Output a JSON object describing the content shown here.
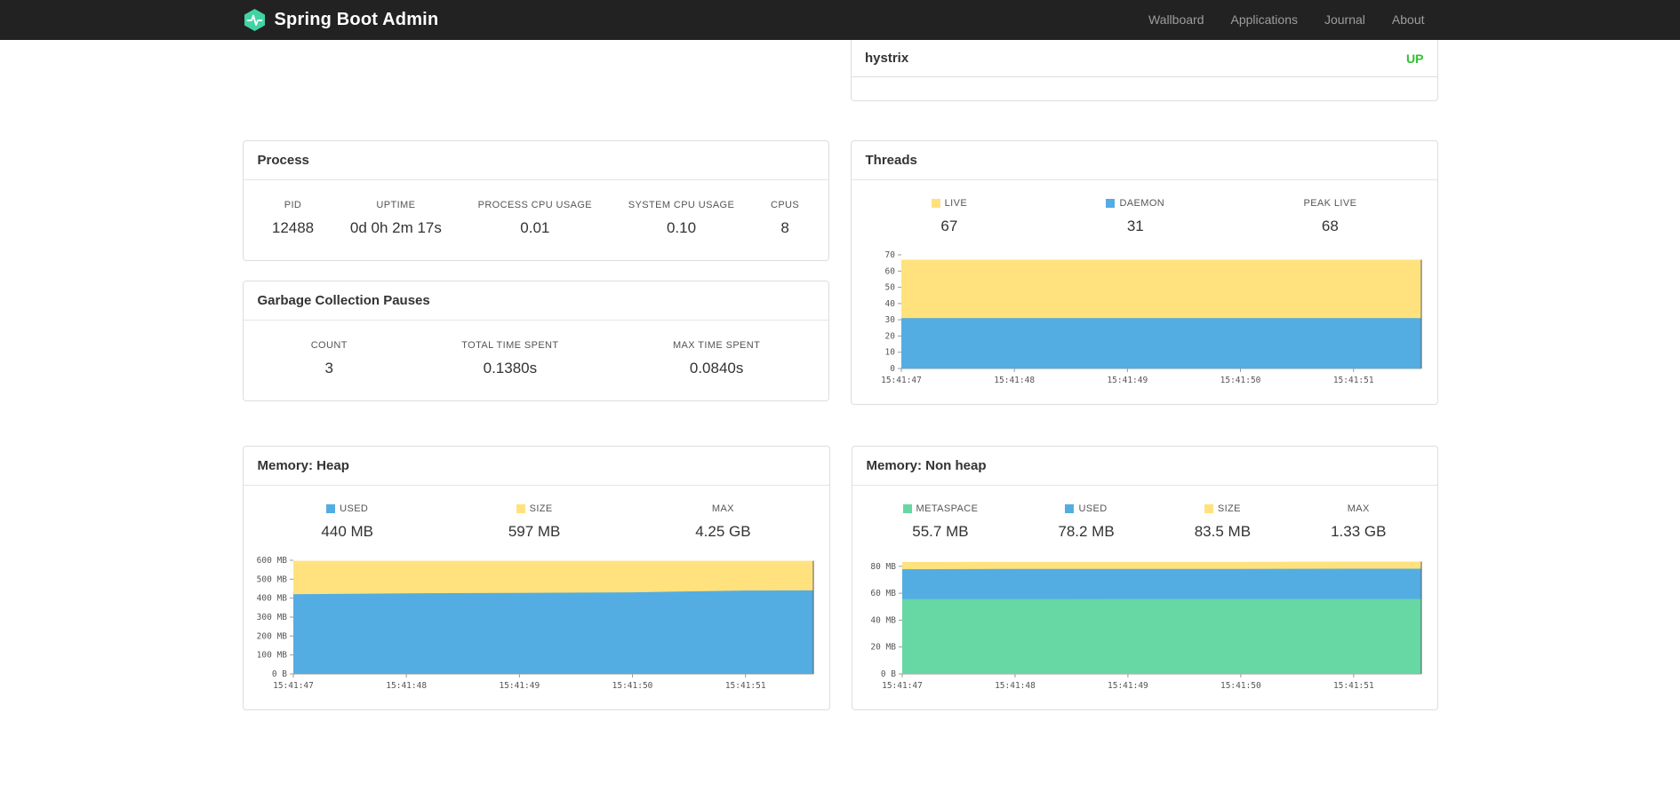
{
  "navbar": {
    "brand": "Spring Boot Admin",
    "links": [
      "Wallboard",
      "Applications",
      "Journal",
      "About"
    ]
  },
  "colors": {
    "brand": "#42d3a5",
    "navbar_bg": "#222222",
    "status_up": "#2fc32f",
    "chart_blue": "#53ade2",
    "chart_yellow": "#ffe27d",
    "chart_green": "#67d7a4"
  },
  "application_row": {
    "name": "hystrix",
    "status": "UP"
  },
  "process": {
    "title": "Process",
    "metrics": [
      {
        "label": "PID",
        "value": "12488"
      },
      {
        "label": "UPTIME",
        "value": "0d 0h 2m 17s"
      },
      {
        "label": "PROCESS CPU USAGE",
        "value": "0.01"
      },
      {
        "label": "SYSTEM CPU USAGE",
        "value": "0.10"
      },
      {
        "label": "CPUS",
        "value": "8"
      }
    ]
  },
  "gc": {
    "title": "Garbage Collection Pauses",
    "metrics": [
      {
        "label": "COUNT",
        "value": "3"
      },
      {
        "label": "TOTAL TIME SPENT",
        "value": "0.1380s"
      },
      {
        "label": "MAX TIME SPENT",
        "value": "0.0840s"
      }
    ]
  },
  "chart_data": [
    {
      "type": "area",
      "title": "Threads",
      "legend": [
        {
          "label": "LIVE",
          "value": "67",
          "color": "#ffe27d"
        },
        {
          "label": "DAEMON",
          "value": "31",
          "color": "#53ade2"
        },
        {
          "label": "PEAK LIVE",
          "value": "68"
        }
      ],
      "series": [
        {
          "name": "LIVE",
          "color": "#ffe27d",
          "values": [
            67,
            67,
            67,
            67,
            67,
            67
          ]
        },
        {
          "name": "DAEMON",
          "color": "#53ade2",
          "values": [
            31,
            31,
            31,
            31,
            31,
            31
          ]
        }
      ],
      "ylim": [
        0,
        70
      ],
      "y_ticks": [
        {
          "v": 0,
          "label": "0"
        },
        {
          "v": 10,
          "label": "10"
        },
        {
          "v": 20,
          "label": "20"
        },
        {
          "v": 30,
          "label": "30"
        },
        {
          "v": 40,
          "label": "40"
        },
        {
          "v": 50,
          "label": "50"
        },
        {
          "v": 60,
          "label": "60"
        },
        {
          "v": 70,
          "label": "70"
        }
      ],
      "x_ticks": [
        "15:41:47",
        "15:41:48",
        "15:41:49",
        "15:41:50",
        "15:41:51"
      ],
      "points_t": [
        0,
        1,
        2,
        3,
        4,
        4.6
      ],
      "x_overhang": 0.6
    },
    {
      "type": "area",
      "title": "Memory: Heap",
      "legend": [
        {
          "label": "USED",
          "value": "440 MB",
          "color": "#53ade2"
        },
        {
          "label": "SIZE",
          "value": "597 MB",
          "color": "#ffe27d"
        },
        {
          "label": "MAX",
          "value": "4.25 GB"
        }
      ],
      "series": [
        {
          "name": "SIZE",
          "color": "#ffe27d",
          "values": [
            597,
            597,
            597,
            597,
            597,
            597
          ]
        },
        {
          "name": "USED",
          "color": "#53ade2",
          "values": [
            421,
            425,
            428,
            431,
            440,
            441
          ]
        }
      ],
      "ylim": [
        0,
        600
      ],
      "y_ticks": [
        {
          "v": 0,
          "label": "0 B"
        },
        {
          "v": 100,
          "label": "100 MB"
        },
        {
          "v": 200,
          "label": "200 MB"
        },
        {
          "v": 300,
          "label": "300 MB"
        },
        {
          "v": 400,
          "label": "400 MB"
        },
        {
          "v": 500,
          "label": "500 MB"
        },
        {
          "v": 600,
          "label": "600 MB"
        }
      ],
      "x_ticks": [
        "15:41:47",
        "15:41:48",
        "15:41:49",
        "15:41:50",
        "15:41:51"
      ],
      "points_t": [
        0,
        1,
        2,
        3,
        4,
        4.6
      ],
      "x_overhang": 0.6
    },
    {
      "type": "area",
      "title": "Memory: Non heap",
      "legend": [
        {
          "label": "METASPACE",
          "value": "55.7 MB",
          "color": "#67d7a4"
        },
        {
          "label": "USED",
          "value": "78.2 MB",
          "color": "#53ade2"
        },
        {
          "label": "SIZE",
          "value": "83.5 MB",
          "color": "#ffe27d"
        },
        {
          "label": "MAX",
          "value": "1.33 GB"
        }
      ],
      "series": [
        {
          "name": "SIZE",
          "color": "#ffe27d",
          "values": [
            83.2,
            83.3,
            83.3,
            83.4,
            83.5,
            83.5
          ]
        },
        {
          "name": "USED",
          "color": "#53ade2",
          "values": [
            77.8,
            78.0,
            78.0,
            78.1,
            78.2,
            78.2
          ]
        },
        {
          "name": "METASPACE",
          "color": "#67d7a4",
          "values": [
            55.6,
            55.6,
            55.7,
            55.7,
            55.7,
            55.7
          ]
        }
      ],
      "ylim": [
        0,
        84.5
      ],
      "y_ticks": [
        {
          "v": 0,
          "label": "0 B"
        },
        {
          "v": 20,
          "label": "20 MB"
        },
        {
          "v": 40,
          "label": "40 MB"
        },
        {
          "v": 60,
          "label": "60 MB"
        },
        {
          "v": 80,
          "label": "80 MB"
        }
      ],
      "x_ticks": [
        "15:41:47",
        "15:41:48",
        "15:41:49",
        "15:41:50",
        "15:41:51"
      ],
      "points_t": [
        0,
        1,
        2,
        3,
        4,
        4.6
      ],
      "x_overhang": 0.6
    }
  ]
}
